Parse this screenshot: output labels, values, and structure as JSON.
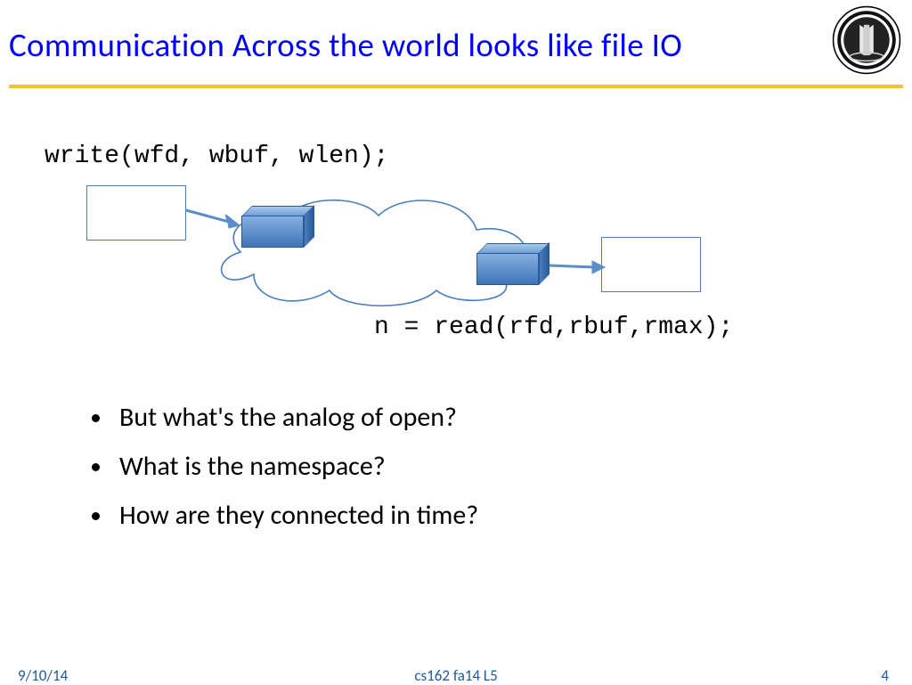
{
  "title": "Communication Across the world looks like file IO",
  "code": {
    "write": "write(wfd, wbuf, wlen);",
    "read": "n = read(rfd,rbuf,rmax);"
  },
  "bullets": [
    "But what's the analog of open?",
    "What is the namespace?",
    "How are they connected in time?"
  ],
  "footer": {
    "date": "9/10/14",
    "course": "cs162 fa14 L5",
    "page": "4"
  }
}
